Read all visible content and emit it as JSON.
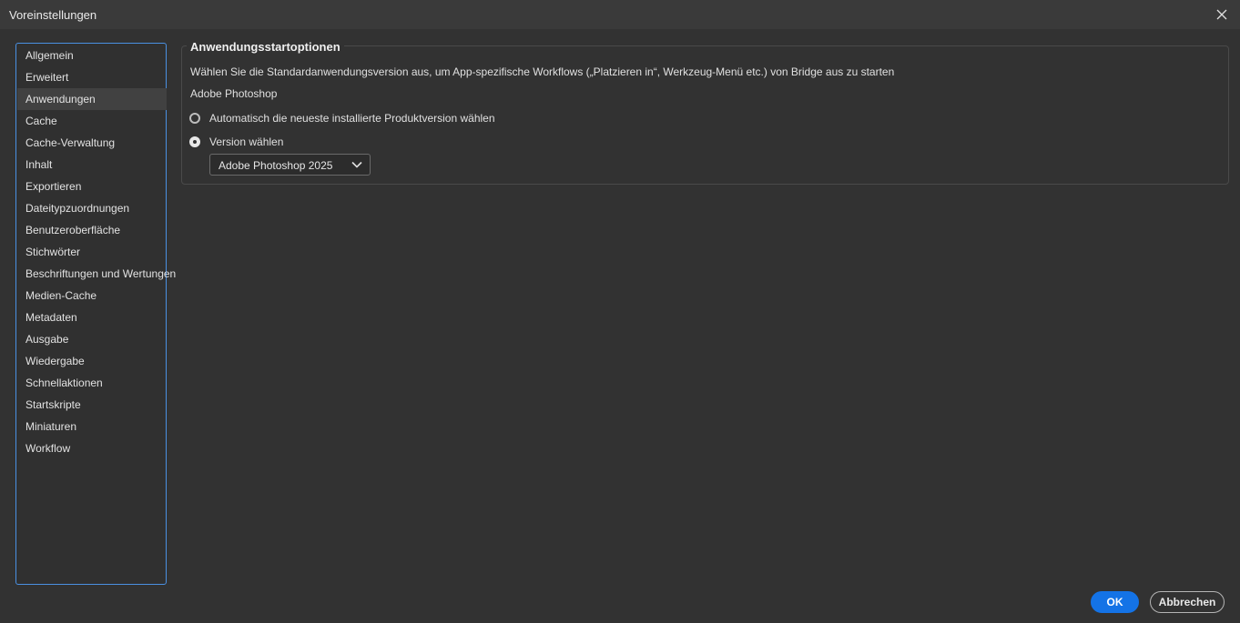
{
  "window": {
    "title": "Voreinstellungen"
  },
  "icons": {
    "close": "close-icon",
    "dropdown": "chevron-down-icon"
  },
  "colors": {
    "accent": "#1473e6",
    "sidebar_border": "#4a90e2",
    "background": "#323232"
  },
  "sidebar": {
    "items": [
      {
        "label": "Allgemein"
      },
      {
        "label": "Erweitert"
      },
      {
        "label": "Anwendungen",
        "selected": true
      },
      {
        "label": "Cache"
      },
      {
        "label": "Cache-Verwaltung"
      },
      {
        "label": "Inhalt"
      },
      {
        "label": "Exportieren"
      },
      {
        "label": "Dateitypzuordnungen"
      },
      {
        "label": "Benutzeroberfläche"
      },
      {
        "label": "Stichwörter"
      },
      {
        "label": "Beschriftungen und Wertungen"
      },
      {
        "label": "Medien-Cache"
      },
      {
        "label": "Metadaten"
      },
      {
        "label": "Ausgabe"
      },
      {
        "label": "Wiedergabe"
      },
      {
        "label": "Schnellaktionen"
      },
      {
        "label": "Startskripte"
      },
      {
        "label": "Miniaturen"
      },
      {
        "label": "Workflow"
      }
    ]
  },
  "main": {
    "section_title": "Anwendungsstartoptionen",
    "description": "Wählen Sie die Standardanwendungsversion aus, um App-spezifische Workflows („Platzieren in“, Werkzeug-Menü etc.) von Bridge aus zu starten",
    "app_label": "Adobe Photoshop",
    "options": [
      {
        "label": "Automatisch die neueste installierte Produktversion wählen",
        "checked": false
      },
      {
        "label": "Version wählen",
        "checked": true
      }
    ],
    "version_select": {
      "value": "Adobe Photoshop 2025"
    }
  },
  "footer": {
    "ok_label": "OK",
    "cancel_label": "Abbrechen"
  }
}
